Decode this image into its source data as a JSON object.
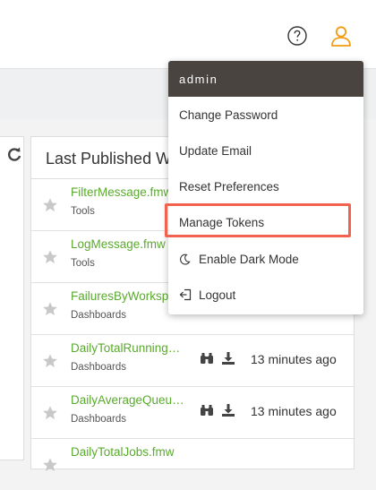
{
  "header": {
    "help_icon": "help-circle-icon",
    "user_icon": "user-icon"
  },
  "panel": {
    "title": "Last Published Wo",
    "rows": [
      {
        "name": "FilterMessage.fmw",
        "category": "Tools",
        "time": ""
      },
      {
        "name": "LogMessage.fmw",
        "category": "Tools",
        "time": ""
      },
      {
        "name": "FailuresByWorksp",
        "category": "Dashboards",
        "time": ""
      },
      {
        "name": "DailyTotalRunning…",
        "category": "Dashboards",
        "time": "13 minutes ago"
      },
      {
        "name": "DailyAverageQueu…",
        "category": "Dashboards",
        "time": "13 minutes ago"
      },
      {
        "name": "DailyTotalJobs.fmw",
        "category": "",
        "time": ""
      }
    ]
  },
  "user_menu": {
    "username": "admin",
    "items": [
      {
        "label": "Change Password",
        "icon": ""
      },
      {
        "label": "Update Email",
        "icon": ""
      },
      {
        "label": "Reset Preferences",
        "icon": ""
      },
      {
        "label": "Manage Tokens",
        "icon": ""
      },
      {
        "label": "Enable Dark Mode",
        "icon": "moon-icon"
      },
      {
        "label": "Logout",
        "icon": "logout-icon"
      }
    ]
  },
  "colors": {
    "accent": "#f39c12",
    "link_green": "#5aaa2e",
    "menu_header": "#4a4441",
    "highlight": "#f26250"
  }
}
